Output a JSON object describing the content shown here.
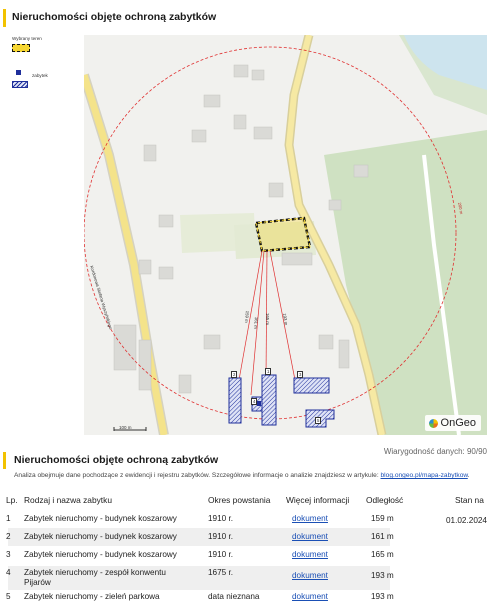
{
  "page": {
    "title": "Nieruchomości objęte ochroną zabytków",
    "section_title": "Nieruchomości objęte ochroną zabytków",
    "reliability": "Wiarygodność danych: 90/90",
    "note_text": "Analiza obejmuje dane pochodzące z ewidencji i rejestru zabytków. Szczegółowe informacje o analizie znajdziesz w artykule: ",
    "note_link": "blog.ongeo.pl/mapa-zabytkow",
    "note_end": "."
  },
  "legend": {
    "selected_label": "Wybrany teren",
    "monument_label": "zabytek"
  },
  "map": {
    "street_label": "Kordonowa Stefana Wyszyńskiego",
    "scale_label": "100 m",
    "radius_label": "200 m",
    "logo_text": "OnGeo",
    "distance_labels": [
      "159 m",
      "161 m",
      "165 m",
      "193 m"
    ],
    "markers": [
      "1",
      "2",
      "3",
      "4",
      "5"
    ],
    "colors": {
      "selected_fill": "#f6d632",
      "monument": "#1f2f9b",
      "radius": "#e03131",
      "road": "#f4e38a",
      "forest": "#cfe1c2"
    }
  },
  "table": {
    "headers": {
      "lp": "Lp.",
      "name": "Rodzaj i nazwa zabytku",
      "period": "Okres powstania",
      "more": "Więcej informacji",
      "distance": "Odległość",
      "state": "Stan na"
    },
    "state_date": "01.02.2024",
    "rows": [
      {
        "lp": "1",
        "name": "Zabytek nieruchomy - budynek koszarowy",
        "period": "1910 r.",
        "link": "dokument",
        "distance": "159 m"
      },
      {
        "lp": "2",
        "name": "Zabytek nieruchomy - budynek koszarowy",
        "period": "1910 r.",
        "link": "dokument",
        "distance": "161 m"
      },
      {
        "lp": "3",
        "name": "Zabytek nieruchomy - budynek koszarowy",
        "period": "1910 r.",
        "link": "dokument",
        "distance": "165 m"
      },
      {
        "lp": "4",
        "name": "Zabytek nieruchomy - zespół konwentu",
        "name2": "Pijarów",
        "period": "1675 r.",
        "link": "dokument",
        "distance": "193 m"
      },
      {
        "lp": "5",
        "name": "Zabytek nieruchomy - zieleń parkowa",
        "period": "data nieznana",
        "link": "dokument",
        "distance": "193 m"
      }
    ]
  }
}
